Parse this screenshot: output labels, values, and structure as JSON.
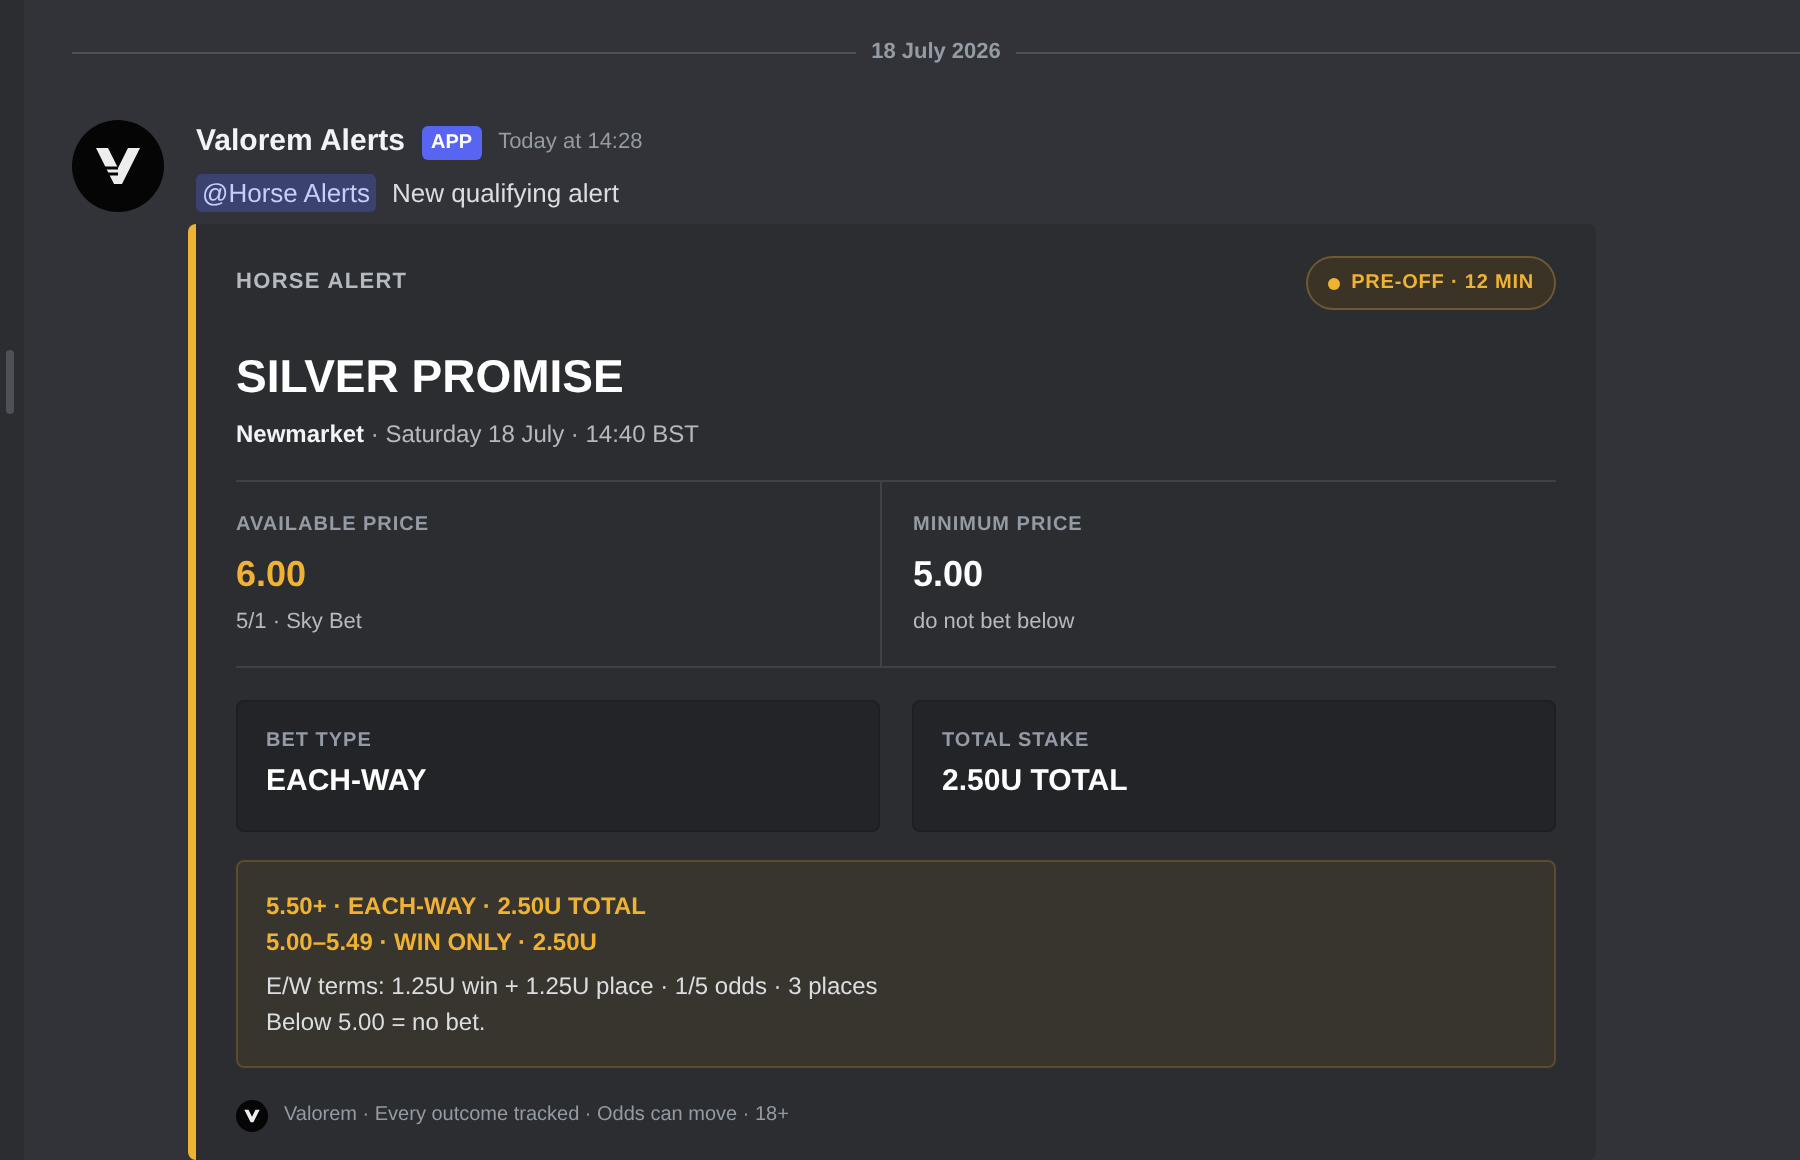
{
  "date_divider": "18 July 2026",
  "message": {
    "author": "Valorem Alerts",
    "tag": "APP",
    "time": "Today at 14:28",
    "mention": "@Horse Alerts",
    "text": "New qualifying alert"
  },
  "embed": {
    "color": "#f0b232",
    "eyebrow": "HORSE ALERT",
    "status": "PRE-OFF · 12 MIN",
    "title": "SILVER PROMISE",
    "venue": "Newmarket",
    "details": " · Saturday 18 July · 14:40 BST",
    "prices": [
      {
        "label": "AVAILABLE PRICE",
        "value": "6.00",
        "highlight": true,
        "sub": "5/1 · Sky Bet"
      },
      {
        "label": "MINIMUM PRICE",
        "value": "5.00",
        "highlight": false,
        "sub": "do not bet below"
      }
    ],
    "tiles": [
      {
        "label": "BET TYPE",
        "value": "EACH-WAY"
      },
      {
        "label": "TOTAL STAKE",
        "value": "2.50U TOTAL"
      }
    ],
    "rules": [
      "5.50+ · EACH-WAY · 2.50U TOTAL",
      "5.00–5.49 · WIN ONLY · 2.50U"
    ],
    "notes": [
      "E/W terms: 1.25U win + 1.25U place · 1/5 odds · 3 places",
      "Below 5.00 = no bet."
    ],
    "footer": "Valorem · Every outcome tracked · Odds can move · 18+"
  }
}
